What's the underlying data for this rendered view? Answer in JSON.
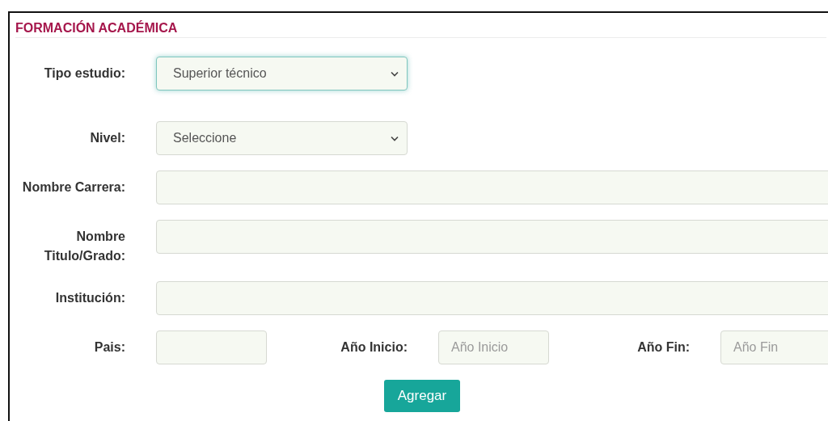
{
  "section": {
    "title": "FORMACIÓN ACADÉMICA"
  },
  "fields": [
    {
      "label": "Tipo estudio:",
      "kind": "select",
      "value": "Superior técnico",
      "focused": true
    },
    {
      "label": "Nivel:",
      "kind": "select",
      "value": "Seleccione",
      "focused": false
    },
    {
      "label": "Nombre Carrera:",
      "kind": "text",
      "focused": false
    },
    {
      "label": "Nombre Titulo/Grado:",
      "kind": "text",
      "focused": false
    },
    {
      "label": "Institución:",
      "kind": "text",
      "focused": false
    }
  ],
  "bottom_row": [
    {
      "label": "Pais:"
    },
    {
      "label": "Año Inicio:",
      "placeholder": "Año Inicio"
    },
    {
      "label": "Año Fin:",
      "placeholder": "Año Fin"
    }
  ],
  "button": {
    "label": "Agregar"
  }
}
